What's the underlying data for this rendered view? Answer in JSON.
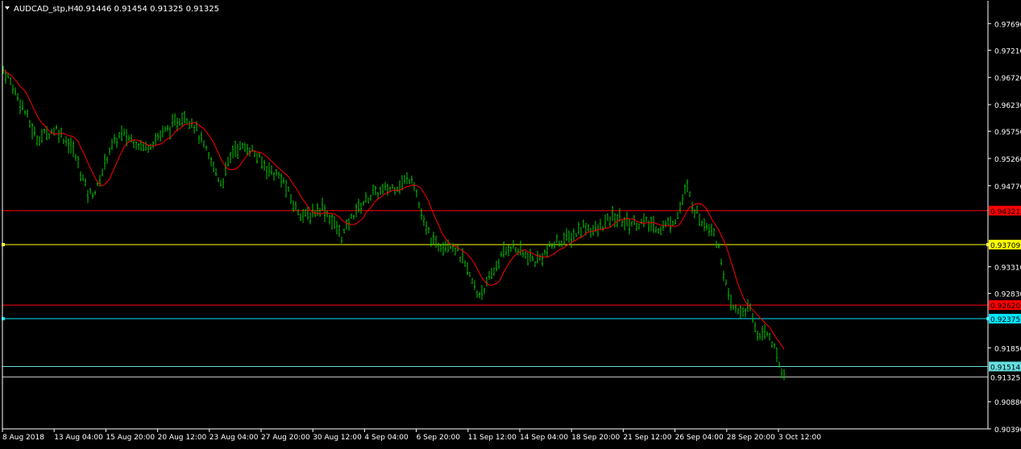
{
  "header": {
    "symbol_timeframe": "AUDCAD_stp,H4",
    "ohlc": "0.91446 0.91454 0.91325 0.91325"
  },
  "chart_data": {
    "type": "candlestick",
    "ylim": [
      0.9039,
      0.981
    ],
    "y_ticks": [
      "0.97690",
      "0.97210",
      "0.96720",
      "0.96230",
      "0.95750",
      "0.95260",
      "0.94770",
      "0.93310",
      "0.92830",
      "0.91850",
      "0.90880",
      "0.90390"
    ],
    "x_labels": [
      "8 Aug 2018",
      "13 Aug 04:00",
      "15 Aug 20:00",
      "20 Aug 12:00",
      "23 Aug 04:00",
      "27 Aug 20:00",
      "30 Aug 12:00",
      "4 Sep 04:00",
      "6 Sep 20:00",
      "11 Sep 12:00",
      "14 Sep 04:00",
      "18 Sep 20:00",
      "21 Sep 12:00",
      "26 Sep 04:00",
      "28 Sep 20:00",
      "3 Oct 12:00"
    ],
    "levels": [
      {
        "value": 0.94321,
        "label": "0.94321",
        "color": "#ff0000",
        "label_bg": "#ff0000",
        "label_fg": "#000000"
      },
      {
        "value": 0.93709,
        "label": "0.93709",
        "color": "#ffff00",
        "label_bg": "#ffff00",
        "label_fg": "#000000"
      },
      {
        "value": 0.9262,
        "label": "0.92620",
        "color": "#ff0000",
        "label_bg": "#ff0000",
        "label_fg": "#000000"
      },
      {
        "value": 0.92375,
        "label": "0.92375",
        "color": "#00e5ff",
        "label_bg": "#00e5ff",
        "label_fg": "#000000"
      },
      {
        "value": 0.91514,
        "label": "0.91514",
        "color": "#66e0e0",
        "label_bg": "#66e0e0",
        "label_fg": "#000000"
      },
      {
        "value": 0.91325,
        "label": "0.91325",
        "color": "#c0c0c0",
        "label_bg": "#000000",
        "label_fg": "#ffffff"
      }
    ],
    "price_anchors": [
      [
        0,
        0.9695
      ],
      [
        10,
        0.9672
      ],
      [
        28,
        0.962
      ],
      [
        45,
        0.9562
      ],
      [
        70,
        0.958
      ],
      [
        90,
        0.9545
      ],
      [
        110,
        0.946
      ],
      [
        120,
        0.947
      ],
      [
        135,
        0.954
      ],
      [
        150,
        0.957
      ],
      [
        165,
        0.956
      ],
      [
        180,
        0.9545
      ],
      [
        200,
        0.957
      ],
      [
        215,
        0.9585
      ],
      [
        228,
        0.9605
      ],
      [
        240,
        0.959
      ],
      [
        255,
        0.954
      ],
      [
        275,
        0.948
      ],
      [
        290,
        0.9545
      ],
      [
        310,
        0.9545
      ],
      [
        330,
        0.951
      ],
      [
        350,
        0.949
      ],
      [
        365,
        0.944
      ],
      [
        380,
        0.942
      ],
      [
        400,
        0.944
      ],
      [
        425,
        0.9385
      ],
      [
        440,
        0.943
      ],
      [
        460,
        0.946
      ],
      [
        480,
        0.947
      ],
      [
        498,
        0.948
      ],
      [
        512,
        0.9495
      ],
      [
        525,
        0.941
      ],
      [
        540,
        0.937
      ],
      [
        560,
        0.9375
      ],
      [
        575,
        0.934
      ],
      [
        593,
        0.928
      ],
      [
        605,
        0.93
      ],
      [
        620,
        0.9345
      ],
      [
        633,
        0.937
      ],
      [
        648,
        0.9355
      ],
      [
        665,
        0.934
      ],
      [
        690,
        0.9375
      ],
      [
        710,
        0.9385
      ],
      [
        725,
        0.9405
      ],
      [
        740,
        0.9395
      ],
      [
        760,
        0.942
      ],
      [
        780,
        0.941
      ],
      [
        800,
        0.941
      ],
      [
        820,
        0.94
      ],
      [
        840,
        0.942
      ],
      [
        852,
        0.9475
      ],
      [
        860,
        0.944
      ],
      [
        870,
        0.9415
      ],
      [
        885,
        0.94
      ],
      [
        895,
        0.9345
      ],
      [
        905,
        0.9265
      ],
      [
        915,
        0.925
      ],
      [
        930,
        0.9255
      ],
      [
        940,
        0.921
      ],
      [
        955,
        0.921
      ],
      [
        965,
        0.9165
      ],
      [
        973,
        0.9135
      ]
    ],
    "ma": {
      "period": 10,
      "color": "#ff0000"
    },
    "colors": {
      "background": "#000000",
      "bar": "#00c800",
      "axis": "#ffffff",
      "text": "#ffffff"
    }
  }
}
